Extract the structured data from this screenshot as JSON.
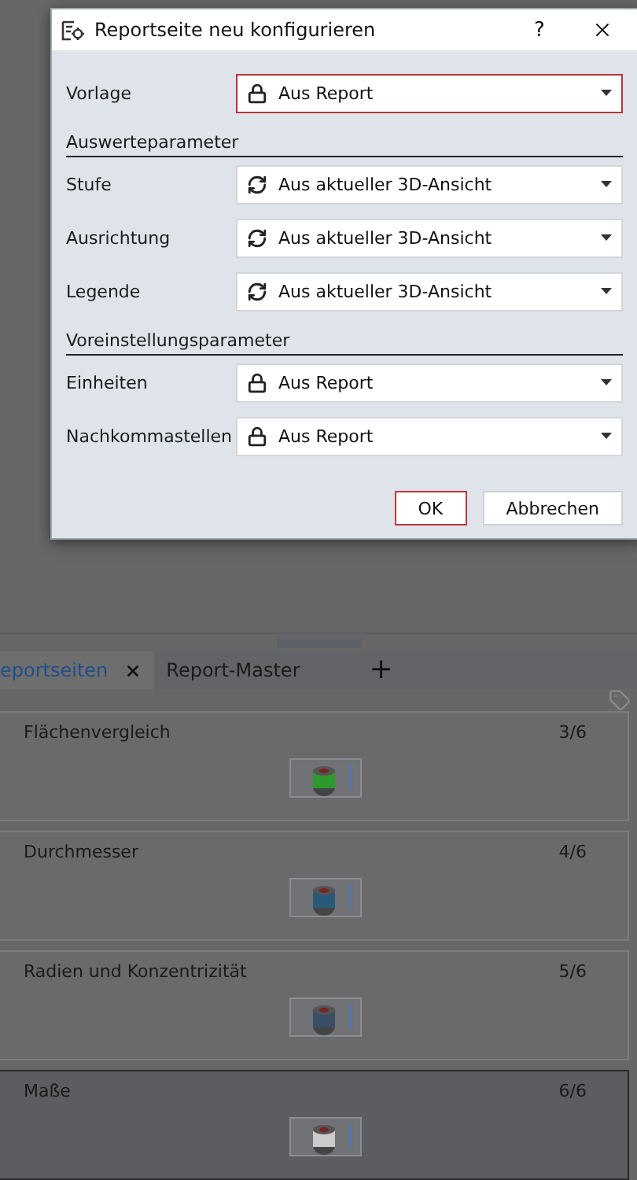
{
  "tabs": [
    {
      "label": "eportseiten",
      "selected": true,
      "closable": true
    },
    {
      "label": "Report-Master",
      "selected": false,
      "closable": false
    }
  ],
  "add_tab": "+",
  "pages": [
    {
      "title": "Flächenvergleich",
      "number": "3/6",
      "selected": false
    },
    {
      "title": "Durchmesser",
      "number": "4/6",
      "selected": false
    },
    {
      "title": "Radien und Konzentrizität",
      "number": "5/6",
      "selected": false
    },
    {
      "title": "Maße",
      "number": "6/6",
      "selected": true
    }
  ],
  "dialog": {
    "title": "Reportseite neu konfigurieren",
    "help": "?",
    "rows": [
      {
        "kind": "locked",
        "label": "Vorlage",
        "value": "Aus Report",
        "focused": true
      },
      {
        "kind": "section",
        "label": "Auswerteparameter"
      },
      {
        "kind": "synced",
        "label": "Stufe",
        "value": "Aus aktueller 3D-Ansicht",
        "focused": false
      },
      {
        "kind": "synced",
        "label": "Ausrichtung",
        "value": "Aus aktueller 3D-Ansicht",
        "focused": false
      },
      {
        "kind": "synced",
        "label": "Legende",
        "value": "Aus aktueller 3D-Ansicht",
        "focused": false
      },
      {
        "kind": "section",
        "label": "Voreinstellungsparameter"
      },
      {
        "kind": "locked",
        "label": "Einheiten",
        "value": "Aus Report",
        "focused": false
      },
      {
        "kind": "locked",
        "label": "Nachkommastellen",
        "value": "Aus Report",
        "focused": false
      }
    ],
    "buttons": [
      {
        "label": "OK",
        "default": true
      },
      {
        "label": "Abbrechen",
        "default": false
      }
    ]
  }
}
